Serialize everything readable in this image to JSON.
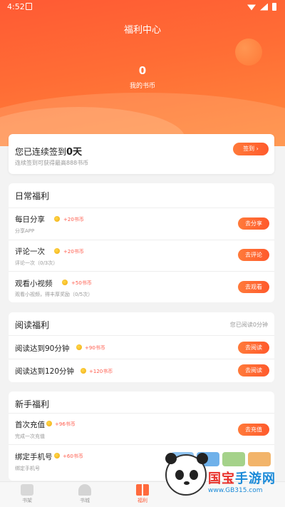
{
  "status_bar": {
    "time": "4:52"
  },
  "header": {
    "title": "福利中心",
    "coin_value": "0",
    "coin_label": "我的书币"
  },
  "checkin": {
    "title_prefix": "您已连续签到",
    "days": "0天",
    "subtitle": "连续签到可获得最高888书币",
    "button": "签到 ›"
  },
  "daily": {
    "title": "日常福利",
    "items": [
      {
        "title": "每日分享",
        "reward": "+20书币",
        "subtitle": "分享APP",
        "button": "去分享"
      },
      {
        "title": "评论一次",
        "reward": "+20书币",
        "subtitle": "评论一次（0/3次）",
        "button": "去评论"
      },
      {
        "title": "观看小视频",
        "reward": "+50书币",
        "subtitle": "观看小视频，得丰厚奖励（0/5次）",
        "button": "去观看"
      }
    ]
  },
  "reading": {
    "title": "阅读福利",
    "status": "您已阅读0分钟",
    "items": [
      {
        "title": "阅读达到90分钟",
        "reward": "+90书币",
        "button": "去阅读"
      },
      {
        "title": "阅读达到120分钟",
        "reward": "+120书币",
        "button": "去阅读"
      }
    ]
  },
  "newbie": {
    "title": "新手福利",
    "items": [
      {
        "title": "首次充值",
        "reward": "+96书币",
        "subtitle": "完成一次充值",
        "button": "去充值"
      },
      {
        "title": "绑定手机号",
        "reward": "+60书币",
        "subtitle": "绑定手机号"
      }
    ]
  },
  "nav": [
    {
      "label": "书架"
    },
    {
      "label": "书城"
    },
    {
      "label": "福利"
    }
  ],
  "watermark": {
    "title_a": "国宝",
    "title_b": "手游网",
    "url": "www.GB315.com"
  },
  "colors": {
    "accent": "#ff5a34",
    "reward": "#ff5a4a"
  }
}
